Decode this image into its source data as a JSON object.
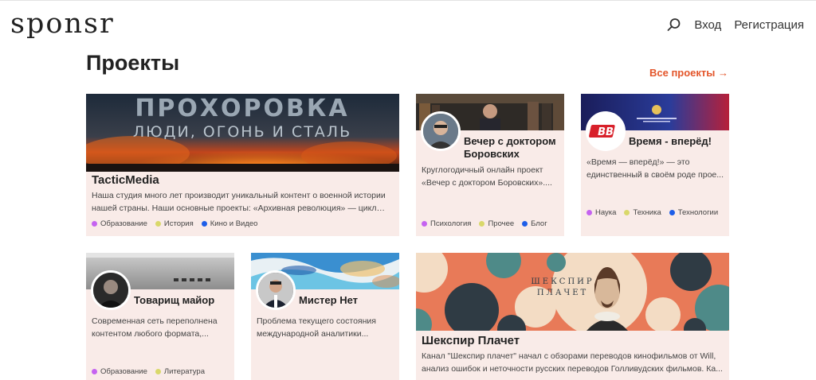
{
  "header": {
    "logo": "sponsr",
    "login": "Вход",
    "register": "Регистрация"
  },
  "page": {
    "title": "Проекты",
    "all_projects": "Все проекты →"
  },
  "colors": {
    "accent": "#e3552a",
    "card_bg": "#f9ebe8",
    "tag_education": "#c563f0",
    "tag_history": "#d9d86a",
    "tag_video": "#1e5ee8"
  },
  "cards": [
    {
      "name": "TacticMedia",
      "cover_text_1": "ПРОХОРОВКА",
      "cover_text_2": "ЛЮДИ, ОГОНЬ И СТАЛЬ",
      "description": "Наша студия много лет производит уникальный контент о военной истории нашей страны. Наши основные проекты: «Архивная революция» — цикл…",
      "tags": [
        "Образование",
        "История",
        "Кино и Видео"
      ]
    },
    {
      "name": "Вечер с доктором Боровских",
      "description": "Круглогодичный онлайн проект «Вечер с доктором Боровских»....",
      "tags": [
        "Психология",
        "Прочее",
        "Блог"
      ]
    },
    {
      "name": "Время - вперёд!",
      "avatar_text": "BB",
      "description": "«Время — вперёд!» — это единственный в своём роде прое...",
      "tags": [
        "Наука",
        "Техника",
        "Технологии"
      ]
    },
    {
      "name": "Товарищ майор",
      "description": "Современная сеть переполнена контентом любого формата,...",
      "tags": [
        "Образование",
        "Литература"
      ]
    },
    {
      "name": "Мистер Нет",
      "description": "Проблема текущего состояния международной аналитики..."
    },
    {
      "name": "Шекспир Плачет",
      "cover_text_1": "ШЕКСПИР",
      "cover_text_2": "ПЛАЧЕТ",
      "description": "Канал \"Шекспир плачет\" начал с обзорами переводов кинофильмов от Will, анализ ошибок и неточности русских переводов Голливудских фильмов. Ка..."
    }
  ]
}
